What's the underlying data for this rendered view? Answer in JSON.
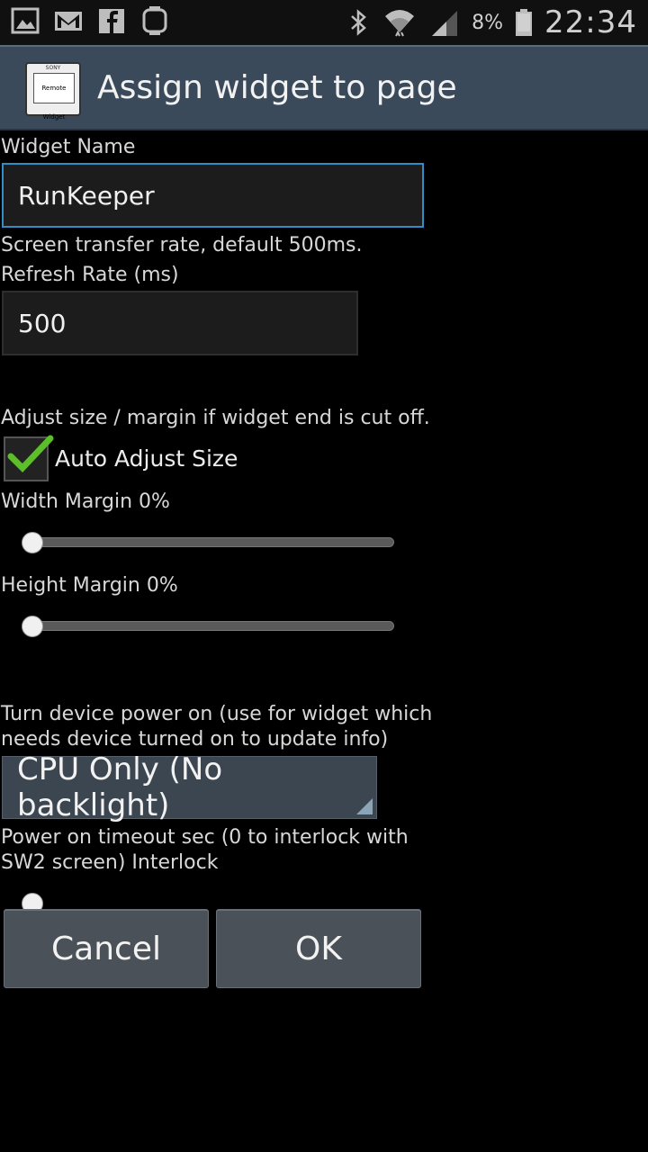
{
  "status_bar": {
    "left_icons": [
      "gallery-icon",
      "gmail-icon",
      "facebook-icon",
      "smartwatch-icon"
    ],
    "right_icons": [
      "bluetooth-icon",
      "wifi-icon",
      "signal-icon"
    ],
    "battery_percent": "8%",
    "time": "22:34"
  },
  "header": {
    "app_icon_brand": "SONY",
    "app_icon_text": "Remote Widget",
    "title": "Assign widget to page"
  },
  "form": {
    "widget_name_label": "Widget Name",
    "widget_name_value": "RunKeeper",
    "refresh_hint": "Screen transfer rate, default 500ms.",
    "refresh_label": "Refresh Rate (ms)",
    "refresh_value": "500",
    "adjust_hint": "Adjust size / margin if widget end is cut off.",
    "auto_adjust_label": "Auto Adjust Size",
    "auto_adjust_checked": true,
    "width_margin_label": "Width Margin 0%",
    "width_margin_value": 0,
    "height_margin_label": "Height Margin 0%",
    "height_margin_value": 0,
    "power_hint_line1": "Turn device power on (use for widget which",
    "power_hint_line2": "needs device turned on to update info)",
    "power_mode_selected": "CPU Only (No backlight)",
    "timeout_label_line1": "Power on timeout sec (0 to interlock with",
    "timeout_label_line2": "SW2 screen) Interlock",
    "timeout_value": 0
  },
  "buttons": {
    "cancel": "Cancel",
    "ok": "OK"
  },
  "colors": {
    "accent_focus": "#2f8fc4",
    "check_green": "#5cbf2a",
    "titlebar": "#3b4a5a"
  }
}
